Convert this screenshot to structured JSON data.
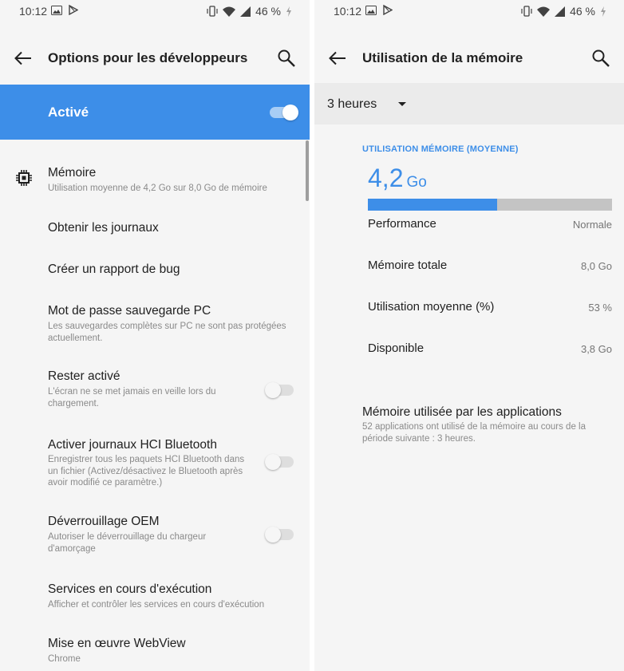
{
  "left": {
    "status": {
      "time": "10:12",
      "battery": "46 %"
    },
    "appbar": {
      "title": "Options pour les développeurs"
    },
    "master": {
      "label": "Activé",
      "enabled": true
    },
    "rows": [
      {
        "title": "Mémoire",
        "subtitle": "Utilisation moyenne de 4,2 Go sur 8,0 Go de mémoire"
      },
      {
        "title": "Obtenir les journaux"
      },
      {
        "title": "Créer un rapport de bug"
      },
      {
        "title": "Mot de passe sauvegarde PC",
        "subtitle": "Les sauvegardes complètes sur PC ne sont pas protégées actuellement."
      },
      {
        "title": "Rester activé",
        "subtitle": "L'écran ne se met jamais en veille lors du chargement.",
        "enabled": false
      },
      {
        "title": "Activer journaux HCI Bluetooth",
        "subtitle": "Enregistrer tous les paquets HCI Bluetooth dans un fichier (Activez/désactivez le Bluetooth après avoir modifié ce paramètre.)",
        "enabled": false
      },
      {
        "title": "Déverrouillage OEM",
        "subtitle": "Autoriser le déverrouillage du chargeur d'amorçage",
        "enabled": false
      },
      {
        "title": "Services en cours d'exécution",
        "subtitle": "Afficher et contrôler les services en cours d'exécution"
      },
      {
        "title": "Mise en œuvre WebView",
        "subtitle": "Chrome"
      }
    ]
  },
  "right": {
    "status": {
      "time": "10:12",
      "battery": "46 %"
    },
    "appbar": {
      "title": "Utilisation de la mémoire"
    },
    "period": {
      "selected": "3 heures"
    },
    "section_header": "UTILISATION MÉMOIRE (MOYENNE)",
    "usage": {
      "value": "4,2",
      "unit": "Go",
      "fraction_used": 0.53
    },
    "stats": [
      {
        "label": "Performance",
        "value": "Normale"
      },
      {
        "label": "Mémoire totale",
        "value": "8,0 Go"
      },
      {
        "label": "Utilisation moyenne (%)",
        "value": "53 %"
      },
      {
        "label": "Disponible",
        "value": "3,8 Go"
      }
    ],
    "apps": {
      "title": "Mémoire utilisée par les applications",
      "subtitle": "52 applications ont utilisé de la mémoire au cours de la période suivante : 3 heures."
    }
  },
  "colors": {
    "accent": "#3d8ee8",
    "background": "#f5f5f5",
    "bar_track": "#c4c4c4"
  }
}
